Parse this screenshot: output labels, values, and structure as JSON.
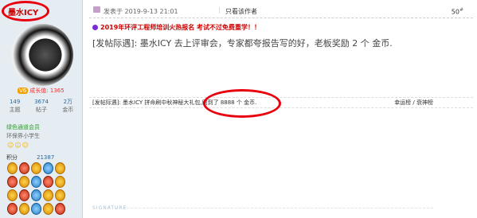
{
  "user": {
    "name": "墨水ICY",
    "growth_label": "成长值",
    "growth_value": "1365",
    "growth_badge": "V6",
    "stats": [
      {
        "value": "149",
        "label": "主题"
      },
      {
        "value": "3674",
        "label": "帖子"
      },
      {
        "value": "2万",
        "label": "金币"
      }
    ],
    "group": "绿色通道会员",
    "level_title": "环保界小学生",
    "stars": "☺☺☺",
    "points_label": "积分",
    "points_value": "21387"
  },
  "post": {
    "date": "发表于 2019-9-13 21:01",
    "separator": "|",
    "only_author": "只看该作者",
    "floor": "50",
    "floor_sup": "#",
    "notice": "2019年环评工程师培训火热报名 考试不过免费重学！！",
    "content": "[发帖际遇]: 墨水ICY 去上评审会，专家都夸报告写的好，老板奖励 2 个 金币.",
    "reward_text": "[发帖际遇]: 墨水ICY 拼命刷中秋神秘大礼包,刷到了 8888 个 金币.",
    "reward_links": "幸运榜 / 衰神榜",
    "signature_label": "SIGNATURE"
  },
  "colors": {
    "sidebar_bg": "#e5edf2",
    "highlight_circle": "#e8000c",
    "notice_red": "#cc0000"
  },
  "icons": [
    "post-icon",
    "notice-icon",
    "growth-badge-icon",
    "medal-icon"
  ]
}
